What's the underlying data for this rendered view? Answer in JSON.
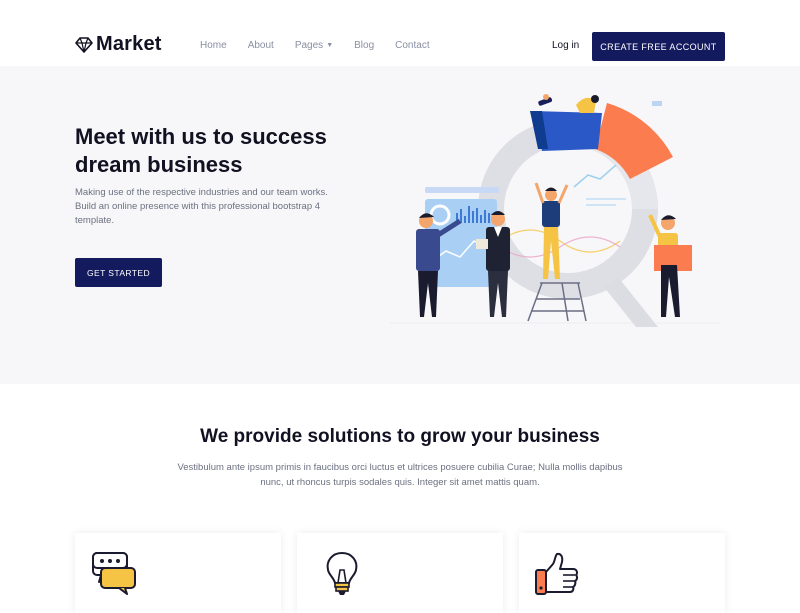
{
  "header": {
    "logo_text": "Market",
    "logo_icon": "diamond-icon",
    "nav": [
      {
        "label": "Home"
      },
      {
        "label": "About"
      },
      {
        "label": "Pages",
        "dropdown": true
      },
      {
        "label": "Blog"
      },
      {
        "label": "Contact"
      }
    ],
    "login_label": "Log in",
    "cta_label": "CREATE FREE ACCOUNT"
  },
  "hero": {
    "title": "Meet with us to success dream business",
    "description": "Making use of the respective industries and our team works. Build an online presence with this professional bootstrap 4 template.",
    "button_label": "GET STARTED",
    "illustration": "business-team-analytics-illustration"
  },
  "solutions": {
    "title": "We provide solutions to grow your business",
    "description": "Vestibulum ante ipsum primis in faucibus orci luctus et ultrices posuere cubilia Curae; Nulla mollis dapibus nunc, ut rhoncus turpis sodales quis. Integer sit amet mattis quam.",
    "cards": [
      {
        "icon": "chat-bubbles-icon"
      },
      {
        "icon": "lightbulb-icon"
      },
      {
        "icon": "thumbs-up-icon"
      }
    ]
  },
  "colors": {
    "primary": "#141a5e",
    "accent_orange": "#fb7c4f",
    "accent_yellow": "#f5c445",
    "hero_bg": "#f7f7f9"
  }
}
